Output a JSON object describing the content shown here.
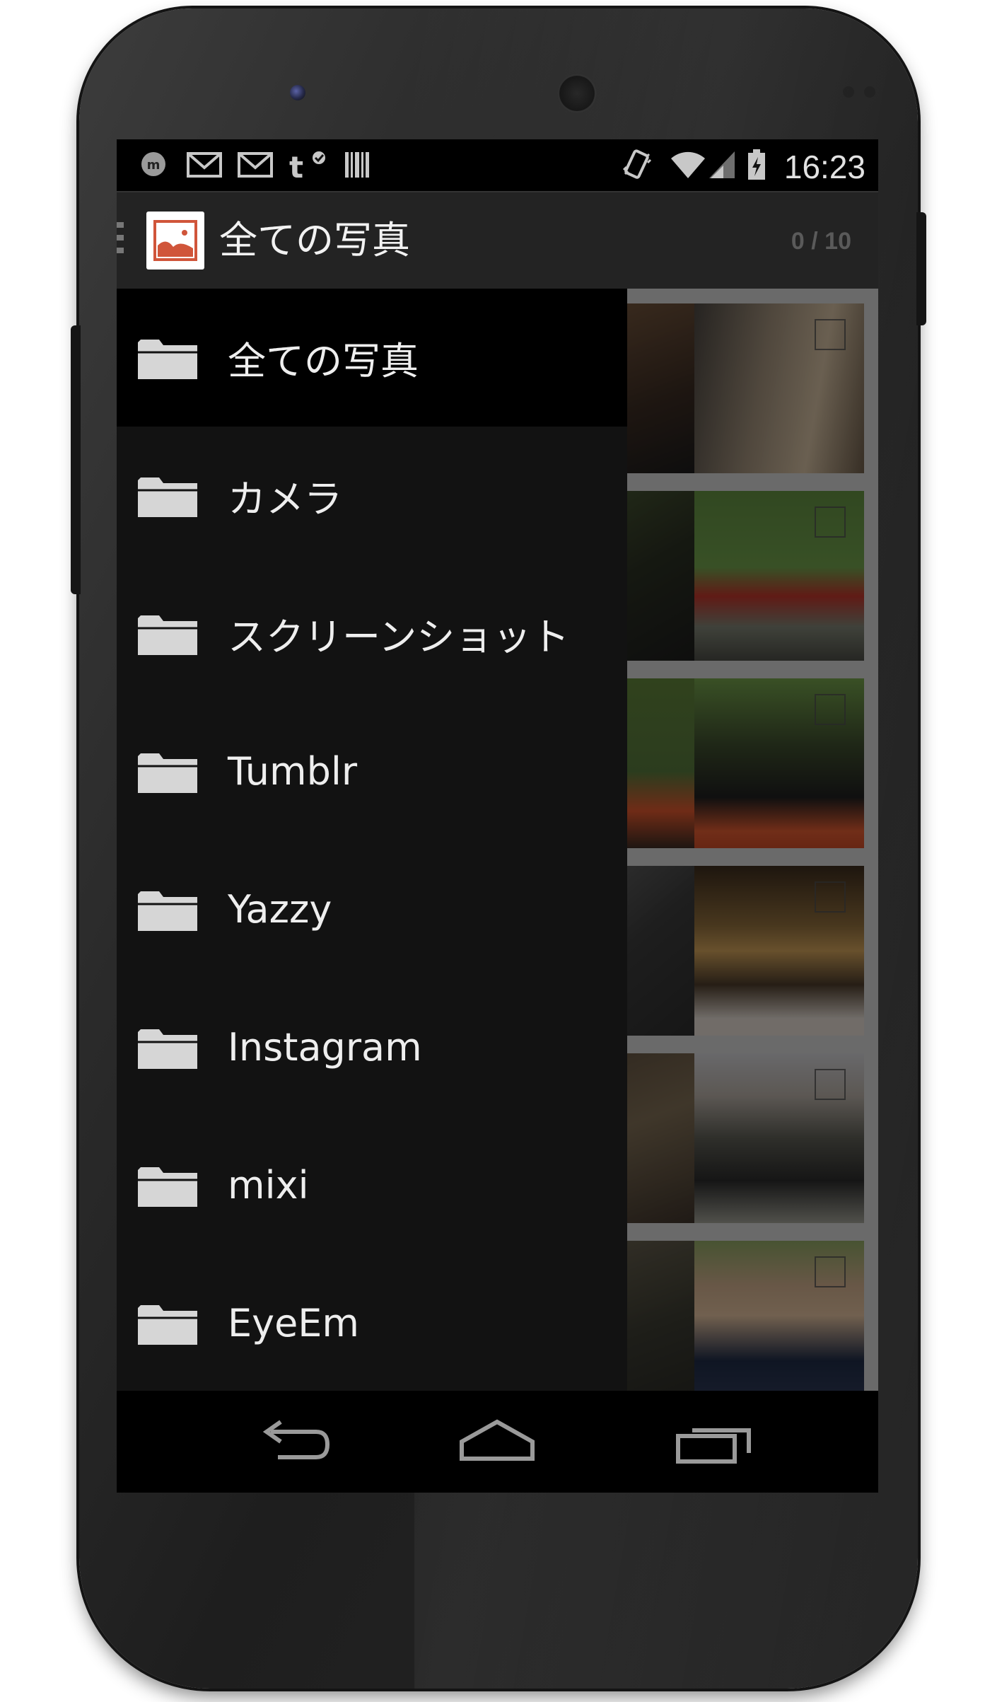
{
  "status_bar": {
    "time": "16:23",
    "left_icons": [
      "messenger-icon",
      "gmail-icon",
      "gmail-icon",
      "tumblr-icon",
      "barcode-icon"
    ],
    "right_icons": [
      "vibrate-icon",
      "wifi-icon",
      "signal-icon",
      "battery-charging-icon"
    ]
  },
  "action_bar": {
    "title": "全ての写真",
    "counter": "0 / 10"
  },
  "drawer": {
    "items": [
      {
        "label": "全ての写真",
        "selected": true
      },
      {
        "label": "カメラ",
        "selected": false
      },
      {
        "label": "スクリーンショット",
        "selected": false
      },
      {
        "label": "Tumblr",
        "selected": false
      },
      {
        "label": "Yazzy",
        "selected": false
      },
      {
        "label": "Instagram",
        "selected": false
      },
      {
        "label": "mixi",
        "selected": false
      },
      {
        "label": "EyeEm",
        "selected": false
      }
    ]
  },
  "nav_bar": {
    "buttons": [
      "back-icon",
      "home-icon",
      "recent-apps-icon"
    ]
  },
  "colors": {
    "drawer_bg": "#121212",
    "drawer_selected": "#000000",
    "action_bar": "#232323",
    "app_icon_accent": "#d0553a"
  }
}
